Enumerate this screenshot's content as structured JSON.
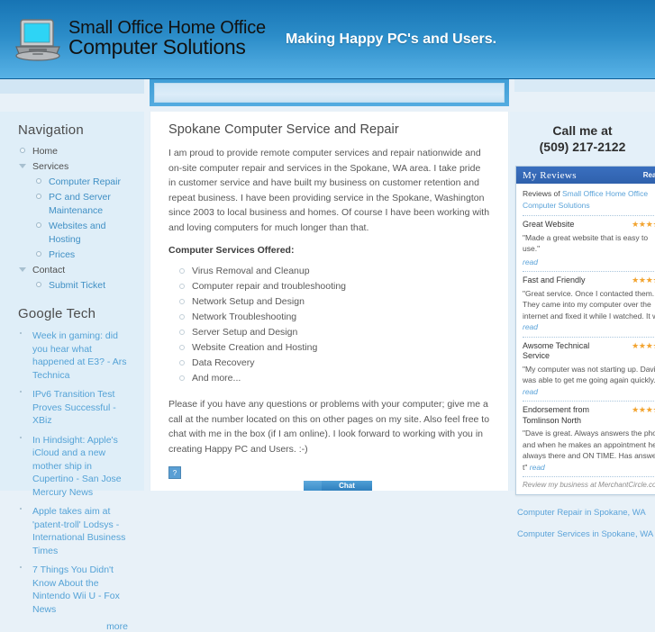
{
  "header": {
    "logo_line1": "Small Office Home Office",
    "logo_line2": "Computer Solutions",
    "logo_icon": "laptop-icon",
    "tagline": "Making Happy PC's and Users.",
    "gradient_top": "#1774b4",
    "gradient_bottom": "#58b2e6"
  },
  "sidebar_left": {
    "nav_title": "Navigation",
    "nav_items": [
      {
        "label": "Home",
        "marker": "circle",
        "style": "plain"
      },
      {
        "label": "Services",
        "marker": "caret",
        "style": "plain"
      },
      {
        "label": "Computer Repair",
        "marker": "circle",
        "style": "link",
        "sub": true
      },
      {
        "label": "PC and Server Maintenance",
        "marker": "circle",
        "style": "link",
        "sub": true
      },
      {
        "label": "Websites and Hosting",
        "marker": "circle",
        "style": "link",
        "sub": true
      },
      {
        "label": "Prices",
        "marker": "circle",
        "style": "link",
        "sub": true
      },
      {
        "label": "Contact",
        "marker": "caret",
        "style": "plain"
      },
      {
        "label": "Submit Ticket",
        "marker": "circle",
        "style": "link",
        "sub": true
      }
    ],
    "feed_title": "Google Tech",
    "feed_items": [
      "Week in gaming: did you hear what happened at E3? - Ars Technica",
      "IPv6 Transition Test Proves Successful - XBiz",
      "In Hindsight: Apple's iCloud and a new mother ship in Cupertino - San Jose Mercury News",
      "Apple takes aim at 'patent-troll' Lodsys - International Business Times",
      "7 Things You Didn't Know About the Nintendo Wii U - Fox News"
    ],
    "feed_more": "more"
  },
  "content": {
    "title": "Spokane Computer Service and Repair",
    "intro": "I am proud to provide remote computer services and repair nationwide and on-site computer repair and services in the Spokane, WA area. I take pride in customer service and have built my business on customer retention and repeat business. I have been providing service in the Spokane, Washington since 2003 to local business and homes. Of course I have been working with and loving computers for much longer than that.",
    "services_heading": "Computer Services Offered:",
    "services": [
      "Virus Removal and Cleanup",
      "Computer repair and troubleshooting",
      "Network Setup and Design",
      "Network Troubleshooting",
      "Server Setup and Design",
      "Website Creation and Hosting",
      "Data Recovery",
      "And more..."
    ],
    "closing": "Please if you have any questions or problems with your computer; give me a call at the number located on this on other pages on my site. Also feel free to chat with me in the box (if I am online). I look forward to working with you in creating Happy PC and Users. :-)",
    "broken_image_glyph": "?"
  },
  "sidebar_right": {
    "call_line1": "Call me at",
    "call_line2": "(509) 217-2122",
    "reviews": {
      "header_title": "My Reviews",
      "header_link": "Read A",
      "intro_prefix": "Reviews of ",
      "intro_link": "Small Office Home Office Computer Solutions",
      "star_color": "#f2a32e",
      "items": [
        {
          "title": "Great Website",
          "stars": "★★★★★",
          "text": "\"Made a great website that is easy to use.\"",
          "read": "read"
        },
        {
          "title": "Fast and Friendly",
          "stars": "★★★★★",
          "text": "\"Great service. Once I contacted them. They came into my computer over the internet and fixed it while I watched. It w\"",
          "read": "read"
        },
        {
          "title": "Awsome Technical Service",
          "stars": "★★★★★",
          "text": "\"My computer was not starting up. David was able to get me going again quickly.\"",
          "read": "read"
        },
        {
          "title": "Endorsement from Tomlinson North",
          "stars": "★★★★★",
          "text": "\"Dave is great. Always answers the phone and when he makes an appointment he is always there and ON TIME. Has answers t\"",
          "read": "read"
        }
      ],
      "footer": "Review my business at MerchantCircle.com"
    },
    "links": [
      "Computer Repair in Spokane, WA",
      "Computer Services in Spokane, WA"
    ]
  },
  "chat_widget": {
    "label": "Chat"
  }
}
